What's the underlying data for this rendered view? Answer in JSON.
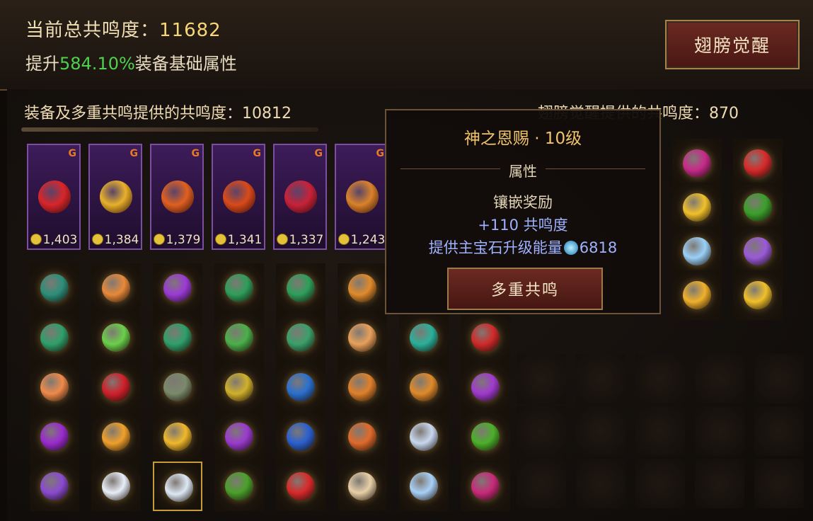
{
  "header": {
    "total_label": "当前总共鸣度：",
    "total_value": "11682",
    "boost_prefix": "提升",
    "boost_pct": "584.10%",
    "boost_suffix": "装备基础属性",
    "wake_button": "翅膀觉醒"
  },
  "equip": {
    "label": "装备及多重共鸣提供的共鸣度：",
    "value": "10812"
  },
  "wings": {
    "label": "翅膀觉醒提供的共鸣度：",
    "value": "870"
  },
  "cards": [
    {
      "value": "1,403",
      "gem_color": "#d8262a"
    },
    {
      "value": "1,384",
      "gem_color": "#e8b12a"
    },
    {
      "value": "1,379",
      "gem_color": "#e06020"
    },
    {
      "value": "1,341",
      "gem_color": "#d94a1a"
    },
    {
      "value": "1,337",
      "gem_color": "#c8223a"
    },
    {
      "value": "1,243",
      "gem_color": "#d9822a"
    }
  ],
  "tooltip": {
    "title": "神之恩赐 · 10级",
    "attr_header": "属性",
    "inlay_reward": "镶嵌奖励",
    "resonance_bonus": "+110 共鸣度",
    "upgrade_text": "提供主宝石升级能量",
    "energy_value": "6818",
    "button": "多重共鸣"
  },
  "grid_colors": [
    [
      "#2c8f7a",
      "#e8893a",
      "#9b3ad6",
      "#2e9e5a",
      "#2e9e5a",
      "#e08a2a",
      "",
      ""
    ],
    [
      "#2ea06a",
      "#6bd04a",
      "#2ea06a",
      "#4ab04a",
      "#3aa06a",
      "#e8a05a",
      "#2ab09a",
      "#d02a2a"
    ],
    [
      "#f08a4a",
      "#d0202a",
      "#7a8a6a",
      "#d0b02a",
      "#2a70d0",
      "#e0802a",
      "#e08a2a",
      "#a03ad0"
    ],
    [
      "#9a2ad0",
      "#f0a02a",
      "#f0b82a",
      "#9a3ad0",
      "#2a60d0",
      "#e06a2a",
      "#c8d8f0",
      "#4ab02a"
    ],
    [
      "#8a4ad0",
      "#e8eef8",
      "#dde8f5",
      "#4aa02a",
      "#d82a2a",
      "#e8d0a8",
      "#a8d0f8",
      "#c82a7a"
    ]
  ],
  "wing_colors": [
    [
      "#c82a8a",
      "#d82a2a"
    ],
    [
      "#f0c02a",
      "#3aa02a"
    ],
    [
      "#9ad0f8",
      "#9a5ad8"
    ],
    [
      "#f0b02a",
      "#f0c02a"
    ]
  ]
}
